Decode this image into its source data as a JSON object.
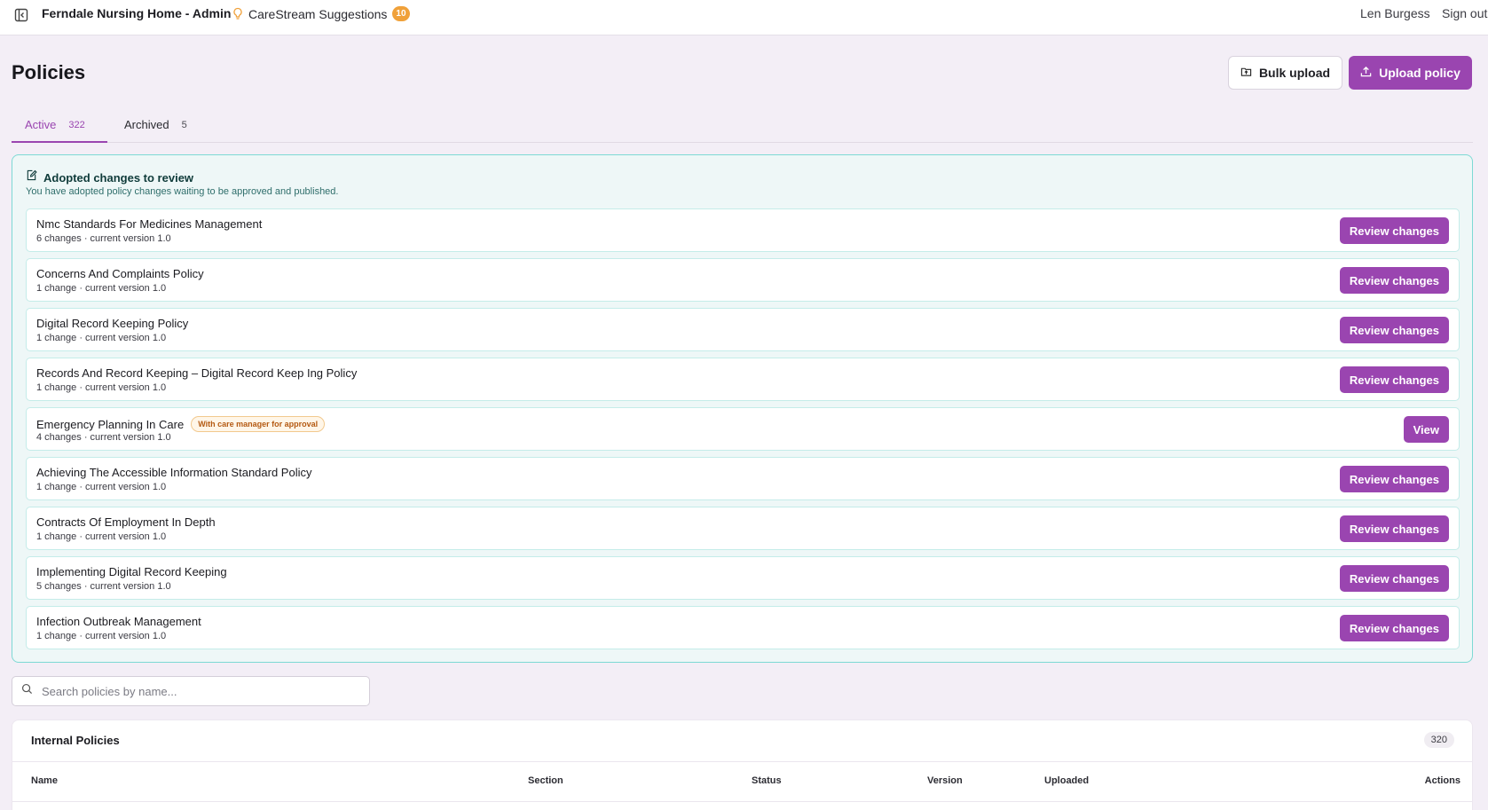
{
  "topbar": {
    "app_title": "Ferndale Nursing Home - Admin",
    "suggestions_label": "CareStream Suggestions",
    "suggestions_count": "10",
    "user_name": "Len Burgess",
    "sign_out": "Sign out"
  },
  "header": {
    "title": "Policies",
    "bulk_upload_label": "Bulk upload",
    "upload_policy_label": "Upload policy"
  },
  "tabs": [
    {
      "label": "Active",
      "count": "322",
      "selected": true
    },
    {
      "label": "Archived",
      "count": "5",
      "selected": false
    }
  ],
  "adopted": {
    "title": "Adopted changes to review",
    "subtitle": "You have adopted policy changes waiting to be approved and published.",
    "items": [
      {
        "name": "Nmc Standards For Medicines Management",
        "meta": "6 changes · current version 1.0",
        "status": "",
        "action": "Review changes"
      },
      {
        "name": "Concerns And Complaints Policy",
        "meta": "1 change · current version 1.0",
        "status": "",
        "action": "Review changes"
      },
      {
        "name": "Digital Record Keeping Policy",
        "meta": "1 change · current version 1.0",
        "status": "",
        "action": "Review changes"
      },
      {
        "name": "Records And Record Keeping – Digital Record Keep Ing Policy",
        "meta": "1 change · current version 1.0",
        "status": "",
        "action": "Review changes"
      },
      {
        "name": "Emergency Planning In Care",
        "meta": "4 changes · current version 1.0",
        "status": "With care manager for approval",
        "action": "View"
      },
      {
        "name": "Achieving The Accessible Information Standard Policy",
        "meta": "1 change · current version 1.0",
        "status": "",
        "action": "Review changes"
      },
      {
        "name": "Contracts Of Employment In Depth",
        "meta": "1 change · current version 1.0",
        "status": "",
        "action": "Review changes"
      },
      {
        "name": "Implementing Digital Record Keeping",
        "meta": "5 changes · current version 1.0",
        "status": "",
        "action": "Review changes"
      },
      {
        "name": "Infection Outbreak Management",
        "meta": "1 change · current version 1.0",
        "status": "",
        "action": "Review changes"
      }
    ]
  },
  "search": {
    "placeholder": "Search policies by name..."
  },
  "internal": {
    "title": "Internal Policies",
    "count": "320",
    "columns": {
      "name": "Name",
      "section": "Section",
      "status": "Status",
      "version": "Version",
      "uploaded": "Uploaded",
      "actions": "Actions"
    }
  },
  "colors": {
    "accent": "#9a45b0",
    "badge": "#f0a13a",
    "panel_border": "#7dd9d4"
  }
}
